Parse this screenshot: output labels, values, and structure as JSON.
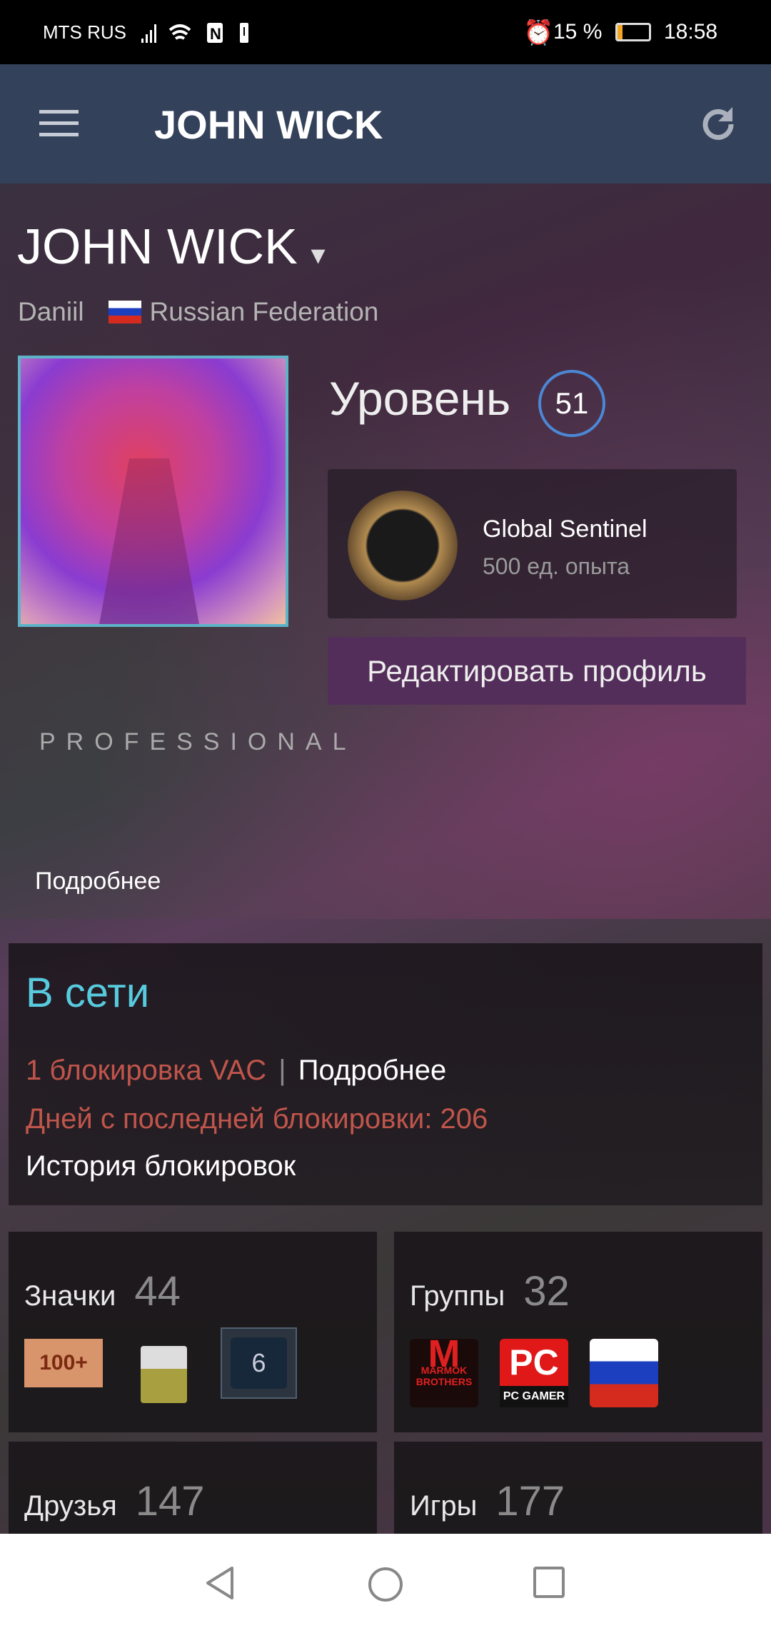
{
  "status_bar": {
    "carrier": "MTS RUS",
    "battery": "15 %",
    "time": "18:58",
    "battery_level_percent": 15,
    "battery_color": "#f5a623"
  },
  "app_bar": {
    "title": "JOHN WICK",
    "menu_icon": "hamburger-icon",
    "refresh_icon": "refresh-icon",
    "color": "#33415a"
  },
  "profile": {
    "name": "JOHN WICK",
    "real_name": "Daniil",
    "country": "Russian Federation",
    "level_label": "Уровень",
    "level": "51",
    "level_ring_color": "#4c87d6",
    "badge": {
      "title": "Global Sentinel",
      "xp": "500 ед. опыта"
    },
    "edit_button": "Редактировать профиль",
    "summary": "PROFESSIONAL",
    "more_link": "Подробнее"
  },
  "status_panel": {
    "state": "В сети",
    "state_color": "#57cbde",
    "vac": "1 блокировка VAC",
    "separator": "|",
    "vac_more": "Подробнее",
    "days_since": "Дней с последней блокировки: 206",
    "ban_history": "История блокировок",
    "ban_color": "#c0554b"
  },
  "cards": [
    {
      "title": "Значки",
      "count": "44",
      "items": [
        "100+",
        "mail-badge",
        "6"
      ]
    },
    {
      "title": "Группы",
      "count": "32",
      "items": [
        "MARMOK BROTHERS",
        "PC GAMER",
        "steam-russia"
      ]
    },
    {
      "title": "Друзья",
      "count": "147"
    },
    {
      "title": "Игры",
      "count": "177"
    }
  ],
  "nav": {
    "back": "back-icon",
    "home": "home-icon",
    "recents": "recents-icon"
  }
}
